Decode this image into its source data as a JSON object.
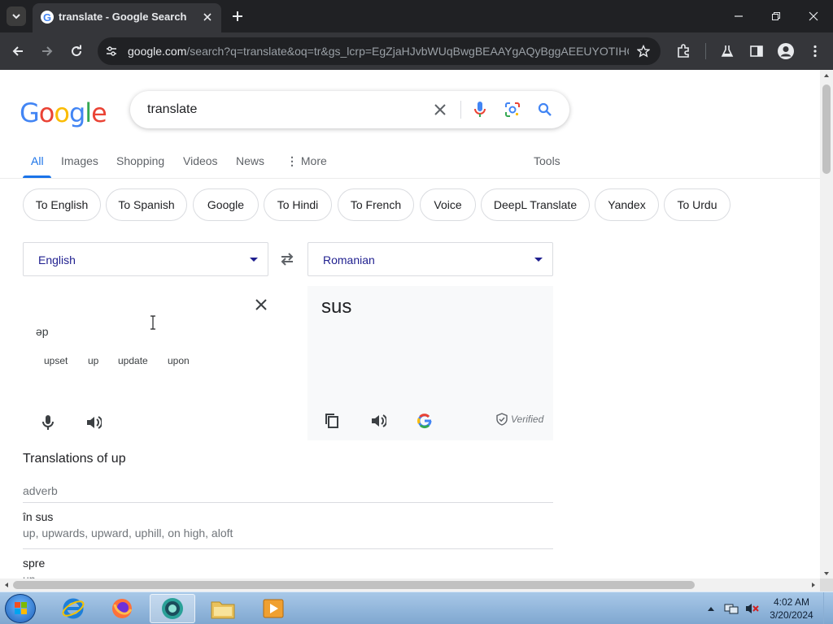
{
  "browser": {
    "tab_title": "translate - Google Search",
    "url_host": "google.com",
    "url_rest": "/search?q=translate&oq=tr&gs_lcrp=EgZjaHJvbWUqBwgBEAAYgAQyBggAEEUYOTIHC..."
  },
  "search": {
    "logo": "Google",
    "query": "translate"
  },
  "search_tabs": [
    {
      "label": "All"
    },
    {
      "label": "Images"
    },
    {
      "label": "Shopping"
    },
    {
      "label": "Videos"
    },
    {
      "label": "News"
    },
    {
      "label": "More"
    },
    {
      "label": "Tools"
    }
  ],
  "chips": [
    {
      "label": "To English"
    },
    {
      "label": "To Spanish"
    },
    {
      "label": "Google"
    },
    {
      "label": "To Hindi"
    },
    {
      "label": "To French"
    },
    {
      "label": "Voice"
    },
    {
      "label": "DeepL Translate"
    },
    {
      "label": "Yandex"
    },
    {
      "label": "To Urdu"
    }
  ],
  "translator": {
    "source_lang": "English",
    "target_lang": "Romanian",
    "phonetic": "əp",
    "suggestions": [
      "upset",
      "up",
      "update",
      "upon"
    ],
    "target_text": "sus",
    "verified_label": "Verified"
  },
  "translations": {
    "heading": "Translations of up",
    "part_of_speech": "adverb",
    "entries": [
      {
        "word": "în sus",
        "synonyms": "up, upwards, upward, uphill, on high, aloft"
      },
      {
        "word": "spre",
        "synonyms": "up"
      }
    ]
  },
  "taskbar": {
    "time": "4:02 AM",
    "date": "3/20/2024"
  },
  "colors": {
    "accent_blue": "#1a73e8",
    "chrome_dark": "#202124",
    "toolbar": "#35363a"
  }
}
